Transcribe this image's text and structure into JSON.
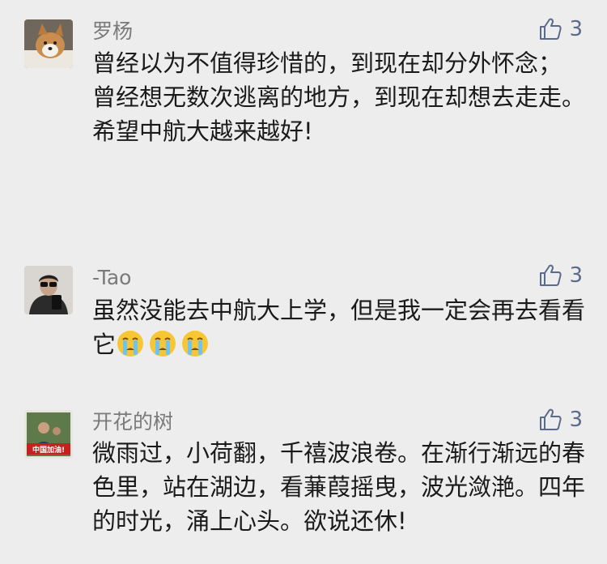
{
  "comments": [
    {
      "username": "罗杨",
      "likes": "3",
      "lines": [
        "曾经以为不值得珍惜的，到现在却分外怀念；",
        "曾经想无数次逃离的地方，到现在却想去走走。",
        "希望中航大越来越好!"
      ]
    },
    {
      "username": "-Tao",
      "likes": "3",
      "text": "虽然没能去中航大上学，但是我一定会再去看看它",
      "emojis": [
        "crying-face-emoji",
        "crying-face-emoji",
        "crying-face-emoji"
      ]
    },
    {
      "username": "开花的树",
      "avatar_text": "中国加油!",
      "likes": "3",
      "text": "微雨过，小荷翻，千禧波浪卷。在渐行渐远的春色里，站在湖边，看蒹葭摇曳，波光潋滟。四年的时光，涌上心头。欲说还休!"
    }
  ],
  "icons": {
    "like": "thumbs-up-icon"
  },
  "colors": {
    "background": "#ededed",
    "username": "#7a7a7a",
    "like": "#5a6b8c",
    "text": "#1a1a1a"
  }
}
